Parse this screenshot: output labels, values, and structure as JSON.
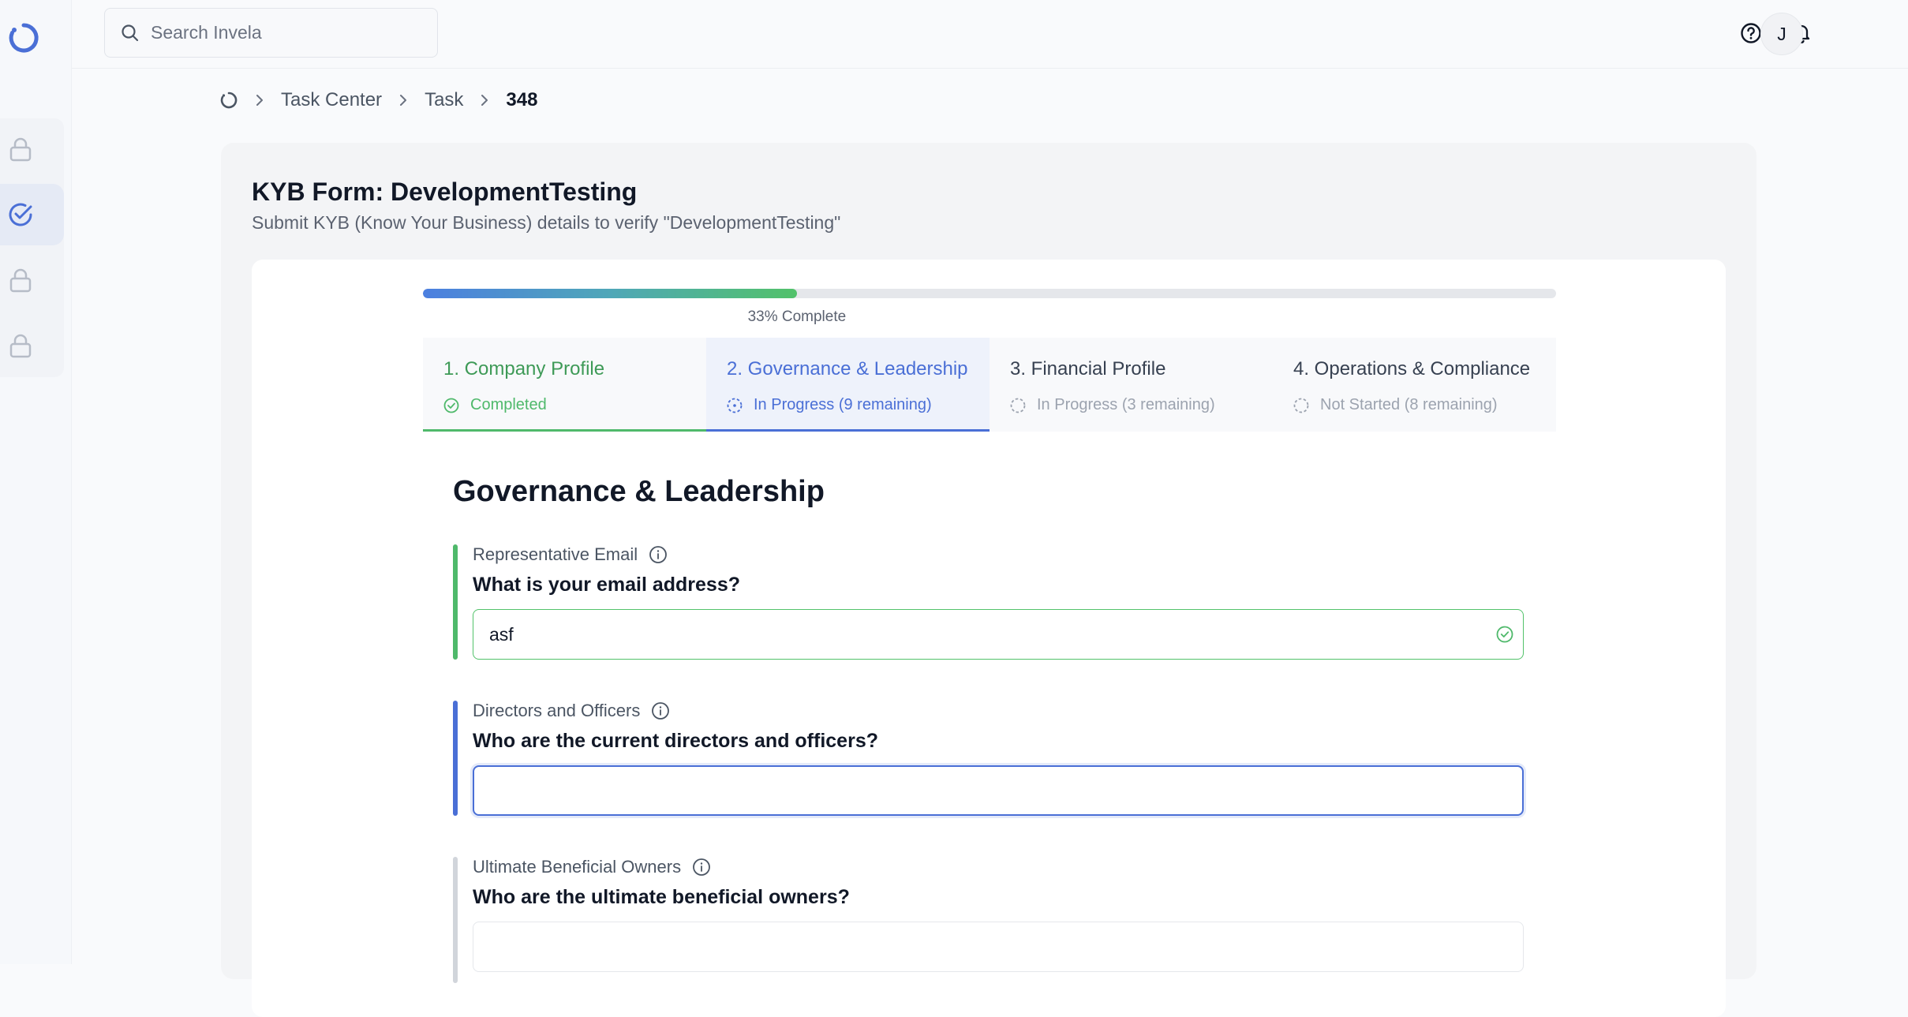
{
  "search": {
    "placeholder": "Search Invela"
  },
  "header": {
    "avatar_initial": "J"
  },
  "breadcrumb": {
    "items": [
      "Task Center",
      "Task"
    ],
    "current": "348"
  },
  "page": {
    "title": "KYB Form: DevelopmentTesting",
    "subtitle": "Submit KYB (Know Your Business) details to verify \"DevelopmentTesting\""
  },
  "progress": {
    "value": 0.33,
    "label": "33% Complete"
  },
  "steps": [
    {
      "title": "1. Company Profile",
      "status": "Completed",
      "state": "completed"
    },
    {
      "title": "2. Governance & Leadership",
      "status": "In Progress (9 remaining)",
      "state": "active"
    },
    {
      "title": "3. Financial Profile",
      "status": "In Progress (3 remaining)",
      "state": "pending"
    },
    {
      "title": "4. Operations & Compliance",
      "status": "Not Started (8 remaining)",
      "state": "pending"
    }
  ],
  "section": {
    "title": "Governance & Leadership"
  },
  "fields": [
    {
      "label": "Representative Email",
      "question": "What is your email address?",
      "value": "asf",
      "state": "valid"
    },
    {
      "label": "Directors and Officers",
      "question": "Who are the current directors and officers?",
      "value": "",
      "state": "focused"
    },
    {
      "label": "Ultimate Beneficial Owners",
      "question": "Who are the ultimate beneficial owners?",
      "value": "",
      "state": "empty"
    }
  ],
  "colors": {
    "accent": "#4a6fd6",
    "success": "#4fb96b",
    "muted": "#9ca3af"
  },
  "icons": {
    "sidebar": [
      "lock-icon",
      "check-circle-icon",
      "lock-icon",
      "lock-icon"
    ],
    "header": [
      "help-icon",
      "bell-icon"
    ]
  }
}
